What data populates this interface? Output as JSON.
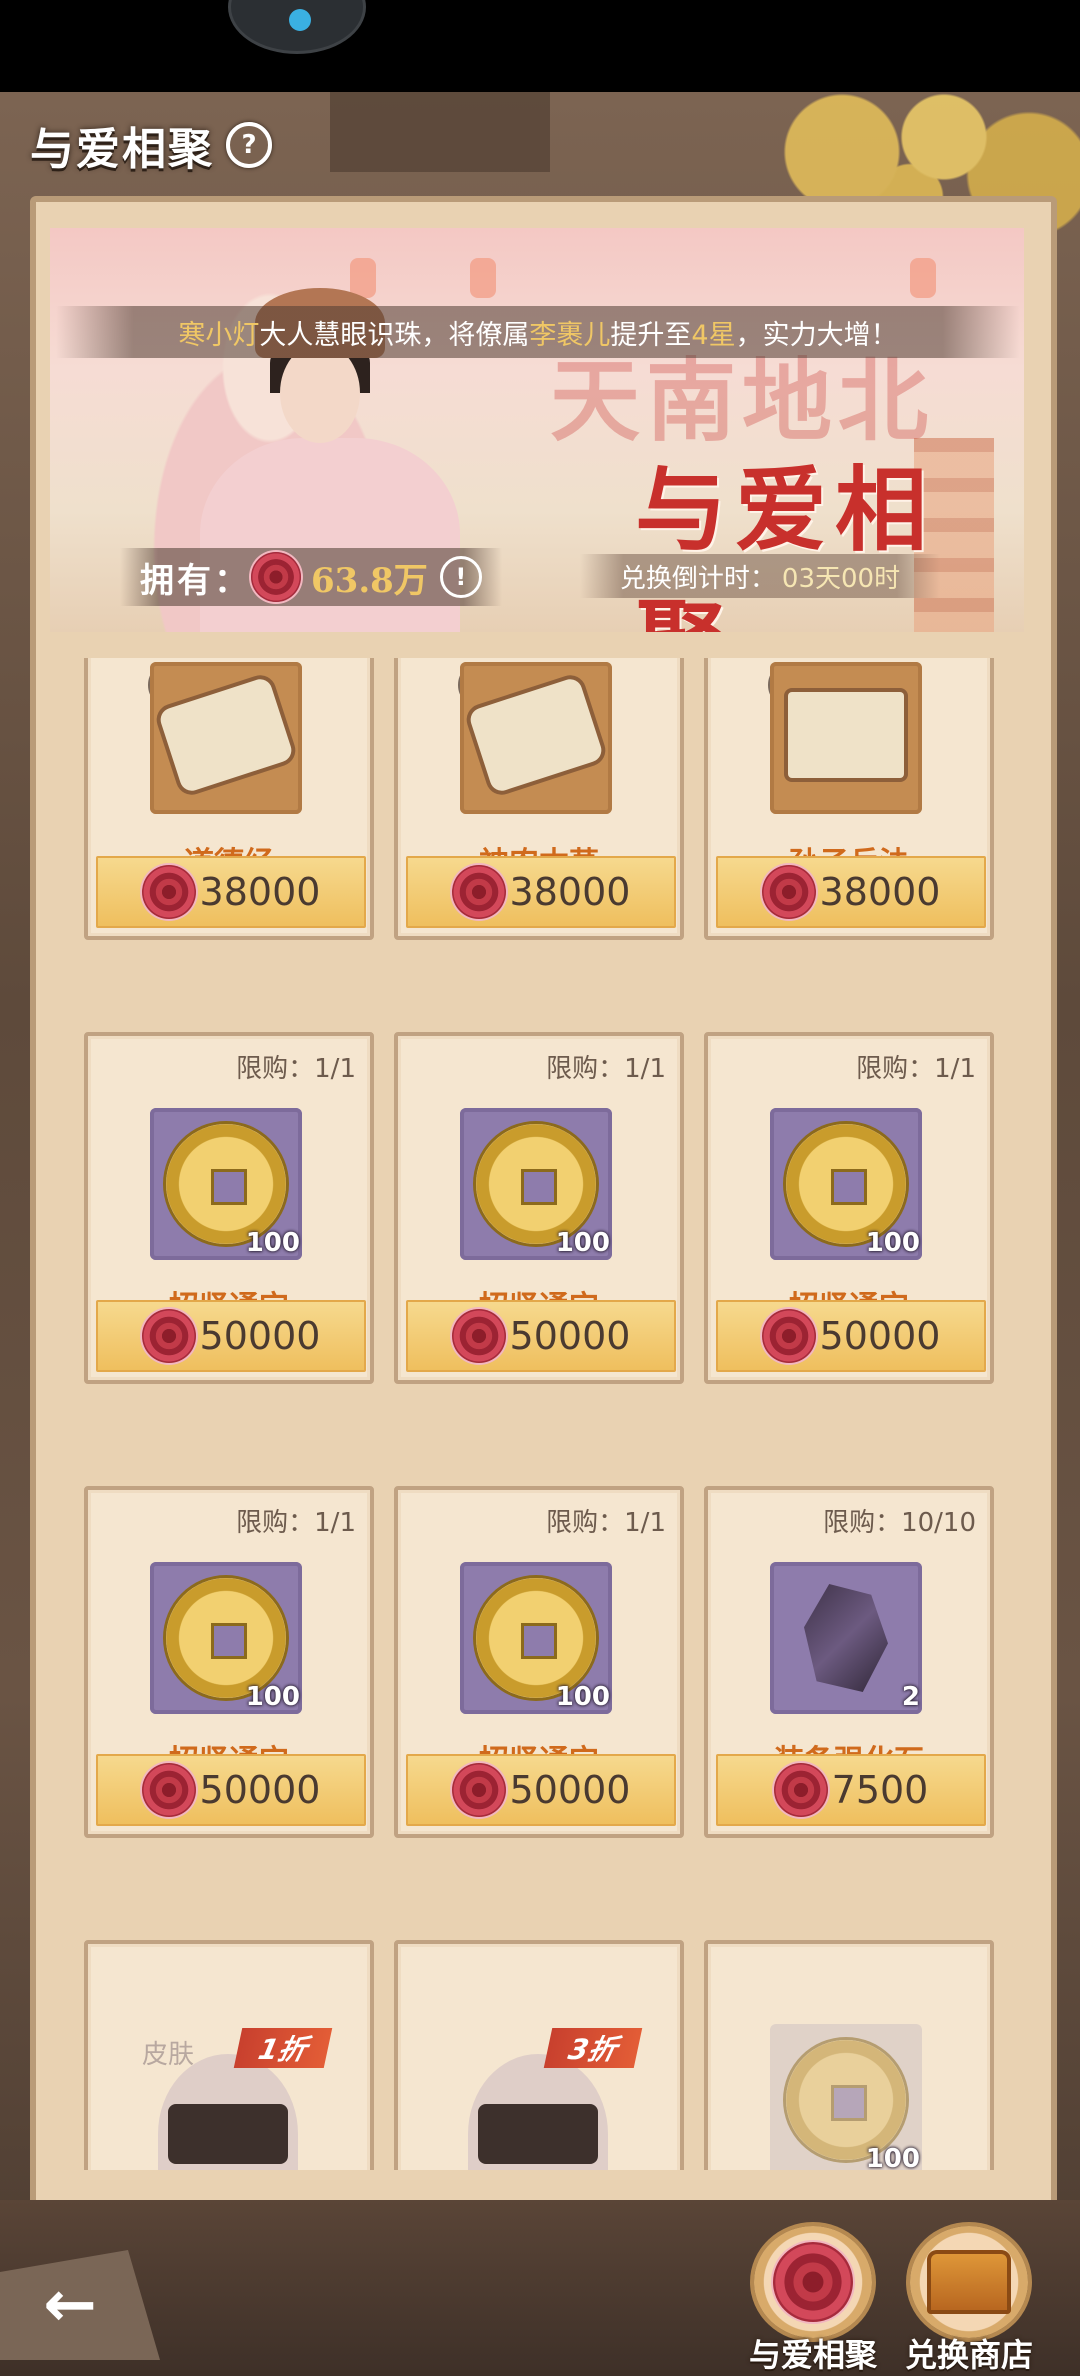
{
  "header": {
    "title": "与爱相聚"
  },
  "banner": {
    "title_line1": "天南地北",
    "title_line2": "与爱相聚",
    "ticker": {
      "name": "寒小灯",
      "text1": "大人慧眼识珠，将僚属",
      "target": "李裹儿",
      "text2": "提升至",
      "stars": "4星",
      "text3": "，实力大增！"
    },
    "owned": {
      "label": "拥有：",
      "value": "63.8万"
    },
    "countdown": {
      "label": "兑换倒计时：",
      "value": "03天00时"
    }
  },
  "items": [
    {
      "name": "道德经",
      "price": "38000",
      "limit": "",
      "qty": "",
      "icon": "scroll-icon"
    },
    {
      "name": "神农本草",
      "price": "38000",
      "limit": "",
      "qty": "",
      "icon": "scroll-icon"
    },
    {
      "name": "孙子兵法",
      "price": "38000",
      "limit": "",
      "qty": "",
      "icon": "book-icon"
    },
    {
      "name": "招贤通宝",
      "price": "50000",
      "limit": "限购：1/1",
      "qty": "100",
      "icon": "coin-icon"
    },
    {
      "name": "招贤通宝",
      "price": "50000",
      "limit": "限购：1/1",
      "qty": "100",
      "icon": "coin-icon"
    },
    {
      "name": "招贤通宝",
      "price": "50000",
      "limit": "限购：1/1",
      "qty": "100",
      "icon": "coin-icon"
    },
    {
      "name": "招贤通宝",
      "price": "50000",
      "limit": "限购：1/1",
      "qty": "100",
      "icon": "coin-icon"
    },
    {
      "name": "招贤通宝",
      "price": "50000",
      "limit": "限购：1/1",
      "qty": "100",
      "icon": "coin-icon"
    },
    {
      "name": "装备强化石",
      "price": "7500",
      "limit": "限购：10/10",
      "qty": "2",
      "icon": "stone-icon"
    },
    {
      "tag": "皮肤",
      "discount": "1折",
      "icon": "skin-icon"
    },
    {
      "discount": "3折",
      "icon": "skin-icon"
    },
    {
      "qty": "100",
      "icon": "coin-icon"
    }
  ],
  "nav": {
    "tab1": "与爱相聚",
    "tab2": "兑换商店"
  },
  "colors": {
    "price_bar": "#efbf5e",
    "item_name": "#d06a1c",
    "highlight": "#f0c765"
  }
}
